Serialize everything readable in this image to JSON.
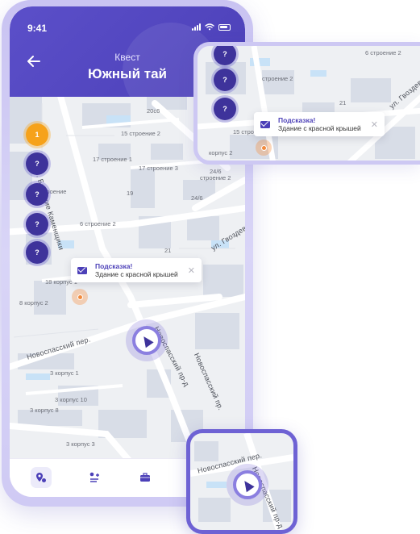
{
  "status_bar": {
    "time": "9:41"
  },
  "header": {
    "subtitle": "Квест",
    "title": "Южный тай",
    "back_icon": "arrow-left-icon"
  },
  "markers": [
    {
      "label": "1",
      "state": "active"
    },
    {
      "label": "?",
      "state": "locked"
    },
    {
      "label": "?",
      "state": "locked"
    },
    {
      "label": "?",
      "state": "locked"
    },
    {
      "label": "?",
      "state": "locked"
    }
  ],
  "zoom_markers": [
    {
      "label": "?"
    },
    {
      "label": "?"
    }
  ],
  "hint": {
    "title": "Подсказка!",
    "body": "Здание с красной крышей",
    "close": "✕"
  },
  "map": {
    "streets": {
      "bolshie_kamenshchiki": "ул. Большие Каменщики",
      "novospassky_per": "Новоспасский пер.",
      "novospassky_pr_d": "Новоспасский пр-д",
      "novospassky_pr": "Новоспасский пр.",
      "gvozdeva": "ул. Гвоздева"
    },
    "buildings": {
      "b20s6": "20с6",
      "b15_2": "15 строение 2",
      "b17_1": "17 строение 1",
      "b17_3": "17 строение 3",
      "b24_6": "24/6",
      "b24_6s": "строение 2",
      "b19": "19",
      "b6_2": "6 строение 2",
      "b21": "21",
      "b18_1": "18 корпус 1",
      "b18_2": "8 корпус 2",
      "b3_1": "3 корпус 1",
      "b3_10": "3 корпус 10",
      "b3_8": "3 корпус 8",
      "b3_3": "3 корпус 3",
      "b5": "5",
      "b_troenie": "троение",
      "zt_6_2": "6 строение 2",
      "zt_21": "21",
      "zt_15_2": "15 строение 2",
      "zt_s2": "строение 2",
      "zt_korpus2": "корпус 2",
      "zt_20s6": "20с6",
      "zt_24_6": "24/6",
      "zt_gvozdeva": "ул. Гвоздева"
    }
  },
  "bottom_nav": [
    {
      "icon": "map-pin-icon",
      "active": true
    },
    {
      "icon": "route-add-icon",
      "active": false
    },
    {
      "icon": "briefcase-icon",
      "active": false
    }
  ],
  "colors": {
    "primary": "#4c40b8",
    "accent": "#f6a21b",
    "map_bg": "#eef0f3",
    "building": "#d5dbe6",
    "road": "#ffffff"
  }
}
